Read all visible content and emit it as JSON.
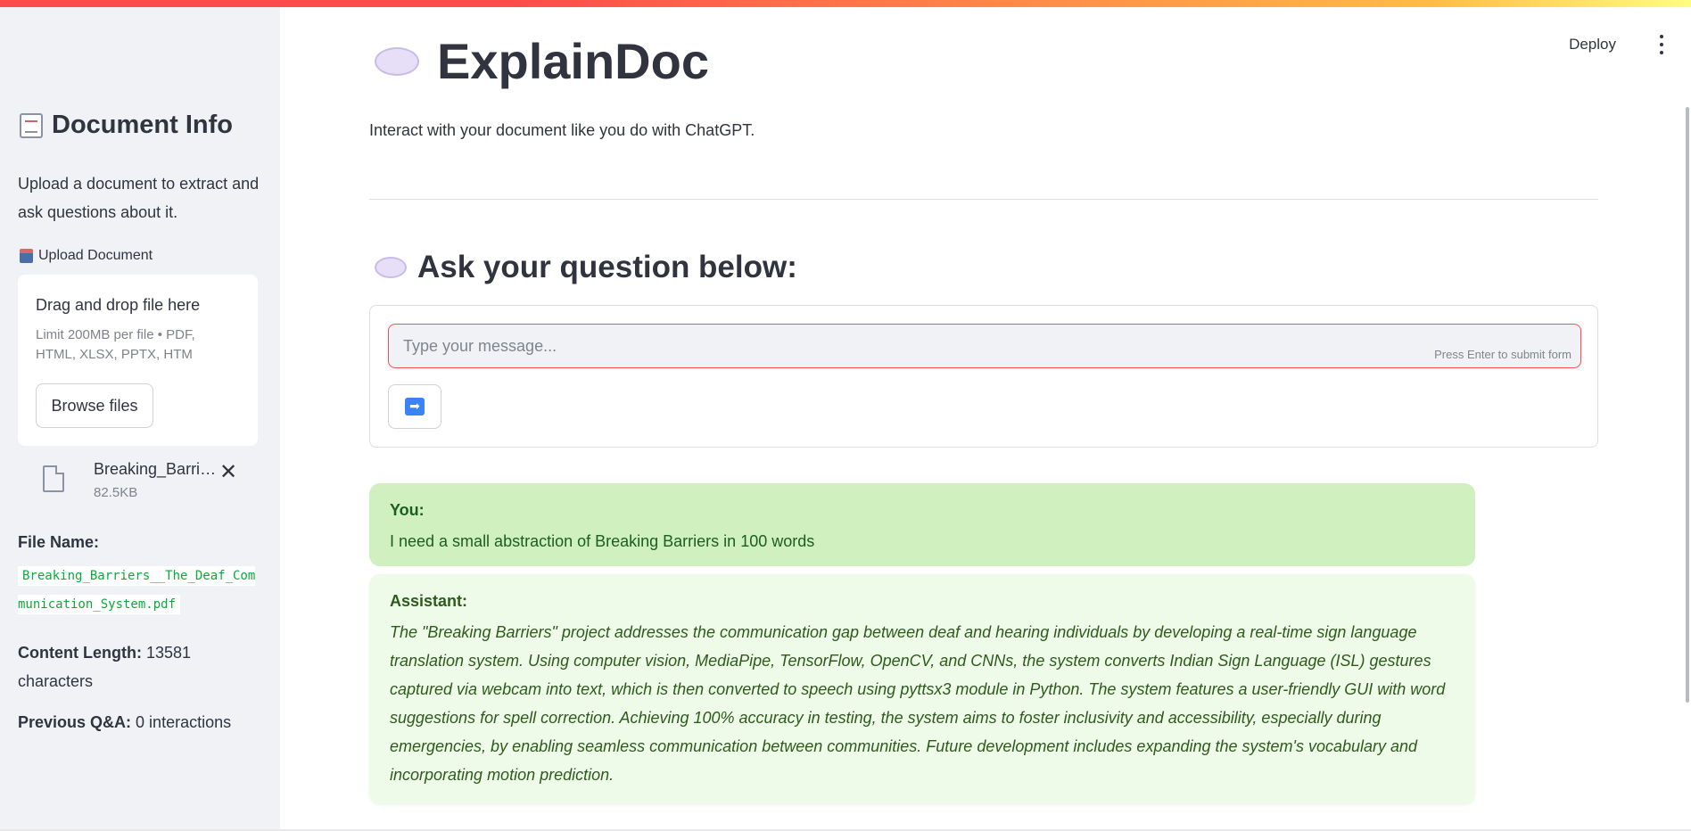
{
  "header": {
    "deploy_label": "Deploy",
    "menu_icon": "kebab-menu-icon"
  },
  "sidebar": {
    "title": "Document Info",
    "title_icon": "document-icon",
    "description": "Upload a document to extract and ask questions about it.",
    "upload_label": "Upload Document",
    "upload_icon": "inbox-tray-icon",
    "dropzone": {
      "title": "Drag and drop file here",
      "limit": "Limit 200MB per file • PDF, HTML, XLSX, PPTX, HTM",
      "browse_label": "Browse files"
    },
    "uploaded_file": {
      "name": "Breaking_Barriers__The_Deaf_Communication_System.pdf",
      "size": "82.5KB"
    },
    "file_name_label": "File Name:",
    "file_name_value": "Breaking_Barriers__The_Deaf_Communication_System.pdf",
    "content_length_label": "Content Length:",
    "content_length_value": "13581 characters",
    "previous_qa_label": "Previous Q&A:",
    "previous_qa_value": "0 interactions"
  },
  "main": {
    "title": "ExplainDoc",
    "subtitle": "Interact with your document like you do with ChatGPT.",
    "ask_heading": "Ask your question below:",
    "input_placeholder": "Type your message...",
    "input_hint": "Press Enter to submit form",
    "submit_icon": "right-arrow-icon",
    "messages": [
      {
        "role": "You:",
        "text": "I need a small abstraction of Breaking Barriers in 100 words"
      },
      {
        "role": "Assistant:",
        "text": "The \"Breaking Barriers\" project addresses the communication gap between deaf and hearing individuals by developing a real-time sign language translation system. Using computer vision, MediaPipe, TensorFlow, OpenCV, and CNNs, the system converts Indian Sign Language (ISL) gestures captured via webcam into text, which is then converted to speech using pyttsx3 module in Python. The system features a user-friendly GUI with word suggestions for spell correction. Achieving 100% accuracy in testing, the system aims to foster inclusivity and accessibility, especially during emergencies, by enabling seamless communication between communities. Future development includes expanding the system's vocabulary and incorporating motion prediction."
      }
    ]
  },
  "colors": {
    "accent": "#ff4b4b",
    "sidebar_bg": "#f0f2f6",
    "user_msg_bg": "#d0f0c0",
    "assistant_msg_bg": "#eefbe8",
    "code_green": "#09ab3b"
  }
}
